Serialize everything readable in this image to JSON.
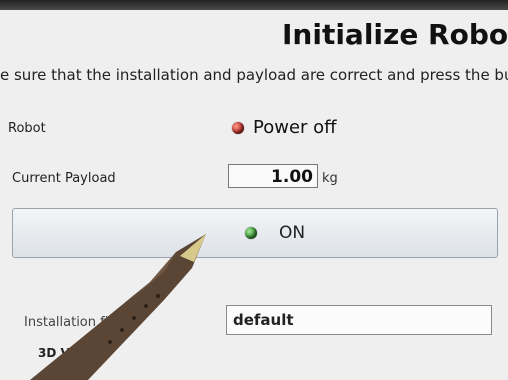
{
  "window": {
    "title": "Initialize Robot"
  },
  "instruction": "e sure that the installation and payload are correct and press the butt",
  "robot": {
    "label": "Robot",
    "status": "Power off",
    "status_color": "#c0312a"
  },
  "payload": {
    "label": "Current Payload",
    "value": "1.00",
    "unit": "kg"
  },
  "power_button": {
    "label": "ON",
    "led_color": "#3a9a36"
  },
  "installation": {
    "label": "Installation fil",
    "value": "default"
  },
  "view": {
    "label": "3D Vie"
  },
  "icons": [
    "red-led-icon",
    "green-led-icon"
  ]
}
